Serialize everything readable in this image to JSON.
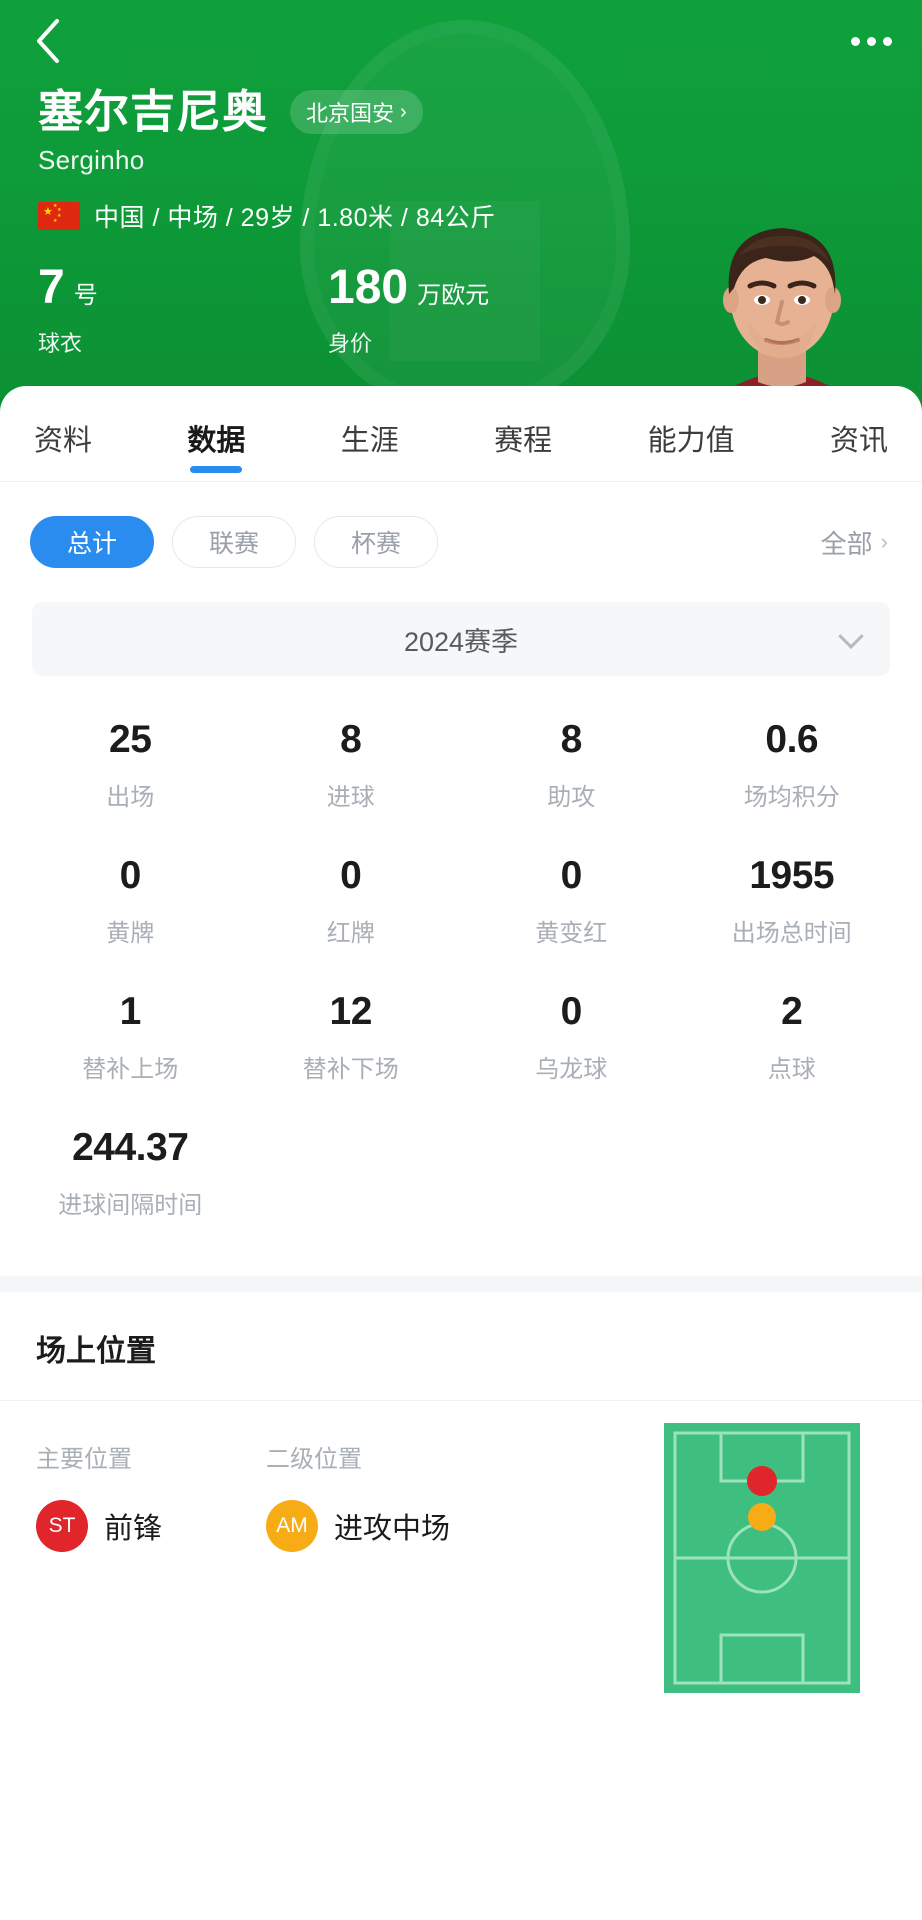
{
  "header": {
    "back_icon": "chevron-left-icon",
    "more_icon": "more-horizontal-icon",
    "player_name_cn": "塞尔吉尼奥",
    "player_name_en": "Serginho",
    "team_label": "北京国安",
    "team_chevron": "›",
    "nationality_flag": "china-flag-icon",
    "meta_text": "中国 / 中场 / 29岁 / 1.80米 / 84公斤",
    "kpis": [
      {
        "value": "7",
        "unit": "号",
        "label": "球衣"
      },
      {
        "value": "180",
        "unit": "万欧元",
        "label": "身价"
      }
    ],
    "portrait_alt": "player-portrait"
  },
  "tabs": [
    {
      "label": "资料",
      "active": false
    },
    {
      "label": "数据",
      "active": true
    },
    {
      "label": "生涯",
      "active": false
    },
    {
      "label": "赛程",
      "active": false
    },
    {
      "label": "能力值",
      "active": false
    },
    {
      "label": "资讯",
      "active": false
    }
  ],
  "filters": {
    "chips": [
      {
        "label": "总计",
        "active": true
      },
      {
        "label": "联赛",
        "active": false
      },
      {
        "label": "杯赛",
        "active": false
      }
    ],
    "all_label": "全部",
    "all_chevron": "›"
  },
  "season": {
    "value": "2024赛季",
    "caret_icon": "chevron-down-icon"
  },
  "stats": [
    {
      "value": "25",
      "label": "出场"
    },
    {
      "value": "8",
      "label": "进球"
    },
    {
      "value": "8",
      "label": "助攻"
    },
    {
      "value": "0.6",
      "label": "场均积分"
    },
    {
      "value": "0",
      "label": "黄牌"
    },
    {
      "value": "0",
      "label": "红牌"
    },
    {
      "value": "0",
      "label": "黄变红"
    },
    {
      "value": "1955",
      "label": "出场总时间"
    },
    {
      "value": "1",
      "label": "替补上场"
    },
    {
      "value": "12",
      "label": "替补下场"
    },
    {
      "value": "0",
      "label": "乌龙球"
    },
    {
      "value": "2",
      "label": "点球"
    },
    {
      "value": "244.37",
      "label": "进球间隔时间"
    },
    {
      "value": "",
      "label": ""
    },
    {
      "value": "",
      "label": ""
    },
    {
      "value": "",
      "label": ""
    }
  ],
  "position_section": {
    "title": "场上位置",
    "primary": {
      "col_label": "主要位置",
      "badge": "ST",
      "badge_color": "#e0252b",
      "name": "前锋"
    },
    "secondary": {
      "col_label": "二级位置",
      "badge": "AM",
      "badge_color": "#f7ac15",
      "name": "进攻中场"
    },
    "pitch": {
      "field_color": "#3fbf7f",
      "line_color": "#9ce2bd",
      "markers": [
        {
          "name": "primary-position-marker",
          "color": "#e0252b",
          "x": 50,
          "y": 22
        },
        {
          "name": "secondary-position-marker",
          "color": "#f7ac15",
          "x": 50,
          "y": 35
        }
      ]
    }
  },
  "colors": {
    "brand_green": "#0e9b39",
    "accent_blue": "#2b8cf0",
    "muted_text": "#a9afb6"
  }
}
